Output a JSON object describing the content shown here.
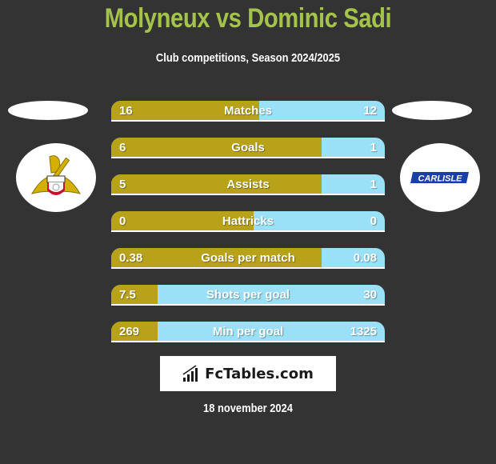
{
  "header": {
    "title": "Molyneux vs Dominic Sadi",
    "subtitle": "Club competitions, Season 2024/2025"
  },
  "players": {
    "left": {
      "name": "Molyneux",
      "club_logo": "doncaster-rovers-crest"
    },
    "right": {
      "name": "Dominic Sadi",
      "club_logo": "carlisle-united-logo",
      "logo_text": "CARLISLE"
    }
  },
  "colors": {
    "title": "#a3c34a",
    "left_bar": "#b8a21a",
    "right_bar": "#9ae1f8",
    "background": "#333333"
  },
  "stats": [
    {
      "label": "Matches",
      "left": "16",
      "right": "12",
      "left_share": 0.54
    },
    {
      "label": "Goals",
      "left": "6",
      "right": "1",
      "left_share": 0.77
    },
    {
      "label": "Assists",
      "left": "5",
      "right": "1",
      "left_share": 0.77
    },
    {
      "label": "Hattricks",
      "left": "0",
      "right": "0",
      "left_share": 0.52
    },
    {
      "label": "Goals per match",
      "left": "0.38",
      "right": "0.08",
      "left_share": 0.77
    },
    {
      "label": "Shots per goal",
      "left": "7.5",
      "right": "30",
      "left_share": 0.17
    },
    {
      "label": "Min per goal",
      "left": "269",
      "right": "1325",
      "left_share": 0.17
    }
  ],
  "footer": {
    "brand": "FcTables.com",
    "brand_icon": "bar-chart-icon",
    "date": "18 november 2024"
  }
}
